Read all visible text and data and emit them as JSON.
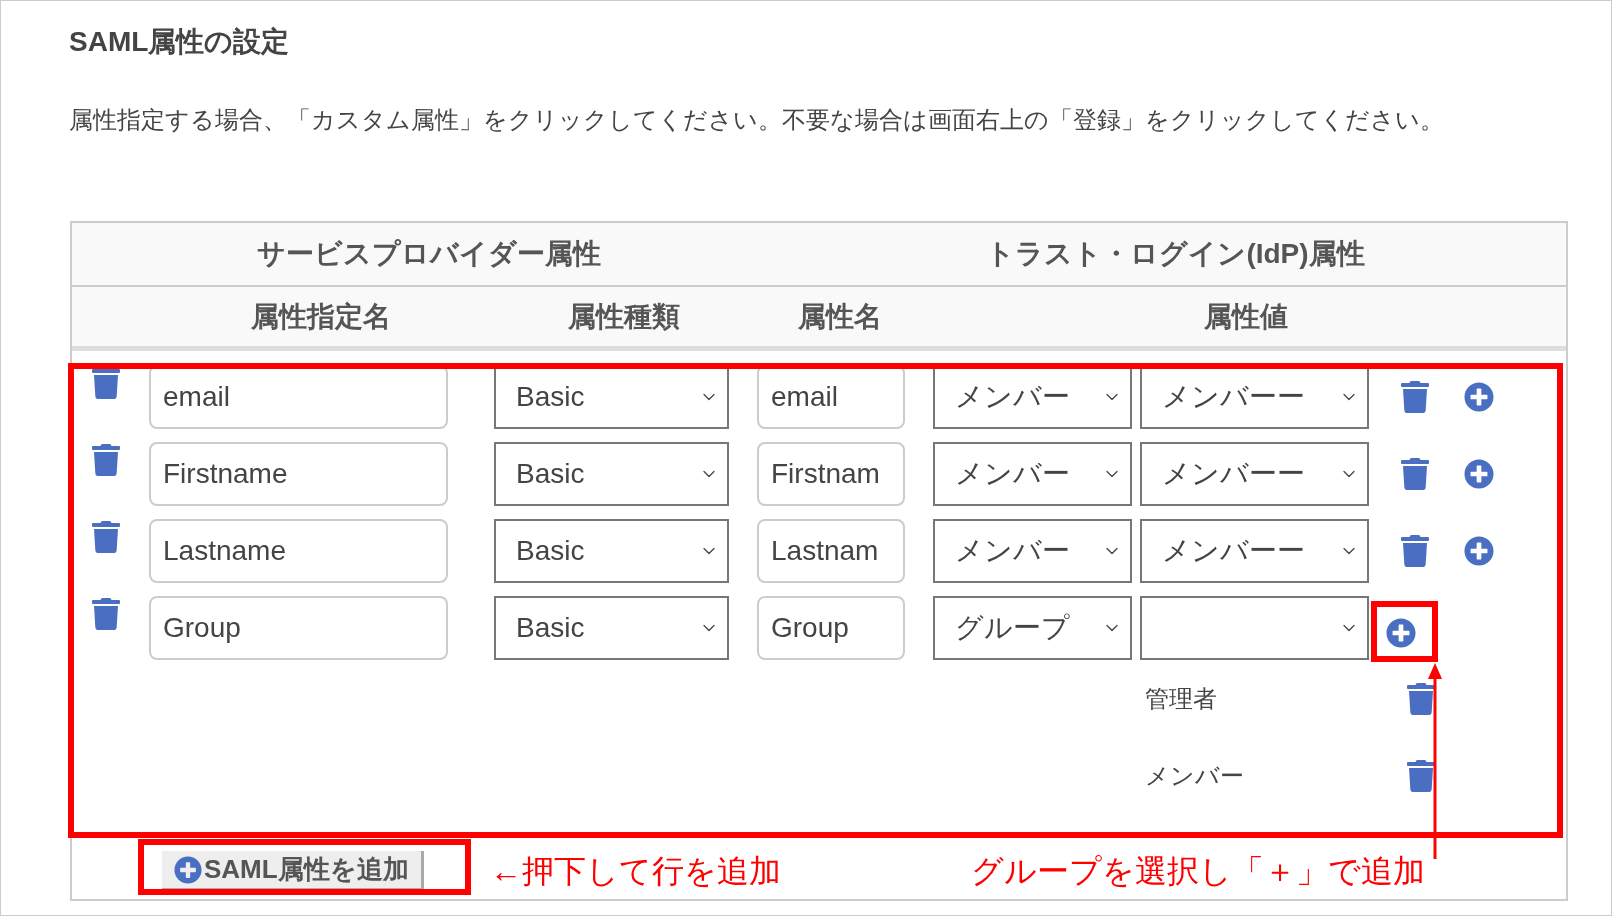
{
  "section": {
    "title": "SAML属性の設定",
    "description": "属性指定する場合、「カスタム属性」をクリックしてください。不要な場合は画面右上の「登録」をクリックしてください。"
  },
  "table": {
    "group_headers": [
      "サービスプロバイダー属性",
      "トラスト・ログイン(IdP)属性"
    ],
    "columns": [
      "属性指定名",
      "属性種類",
      "属性名",
      "属性値"
    ],
    "rows": [
      {
        "kind": "single",
        "name": "email",
        "type": "Basic",
        "attribute": "email",
        "value_kind": "メンバー",
        "value": "メンバーー"
      },
      {
        "kind": "single",
        "name": "Firstname",
        "type": "Basic",
        "attribute": "Firstnam",
        "value_kind": "メンバー",
        "value": "メンバーー"
      },
      {
        "kind": "single",
        "name": "Lastname",
        "type": "Basic",
        "attribute": "Lastnam",
        "value_kind": "メンバー",
        "value": "メンバーー"
      },
      {
        "kind": "group",
        "name": "Group",
        "type": "Basic",
        "attribute": "Group",
        "value_kind": "グループ",
        "groups": [
          "管理者",
          "メンバー"
        ]
      }
    ],
    "add_button": "SAML属性を追加"
  },
  "annotations": [
    "←押下して行を追加",
    "グループを選択し「＋」で追加"
  ]
}
